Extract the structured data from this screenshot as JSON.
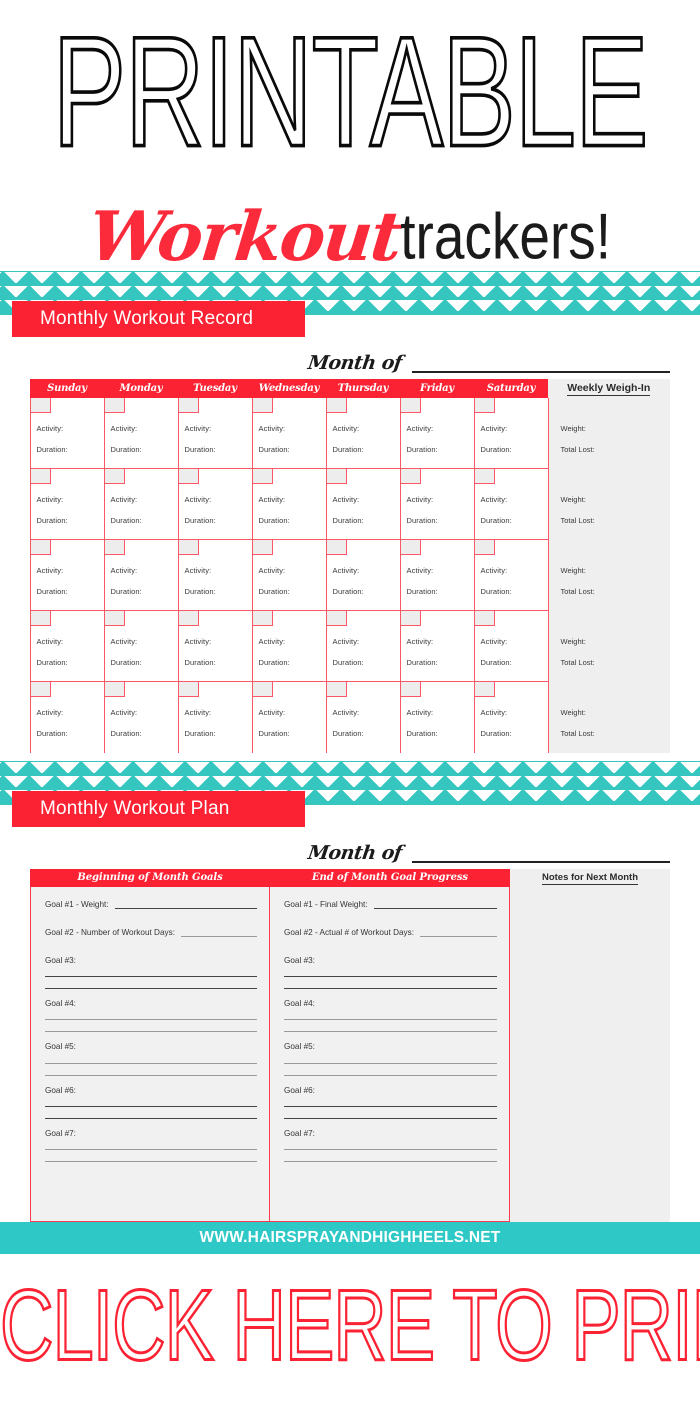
{
  "hero": {
    "title": "PRINTABLE",
    "script_word": "Workout",
    "thin_word": "trackers!"
  },
  "colors": {
    "teal": "#36C6C0",
    "red": "#FB2233",
    "red_light": "#FB5767",
    "gray_panel": "#EFEFEF",
    "footer_teal": "#2EC9C6"
  },
  "section_record": {
    "tab_label": "Monthly Workout Record",
    "month_label": "Month of",
    "day_headers": [
      "Sunday",
      "Monday",
      "Tuesday",
      "Wednesday",
      "Thursday",
      "Friday",
      "Saturday"
    ],
    "weigh_header": "Weekly Weigh-In",
    "cell_labels": {
      "activity": "Activity:",
      "duration": "Duration:"
    },
    "weigh_labels": {
      "weight": "Weight:",
      "total_lost": "Total Lost:"
    },
    "week_count": 5
  },
  "section_plan": {
    "tab_label": "Monthly Workout Plan",
    "month_label": "Month of",
    "begin_header": "Beginning of Month Goals",
    "end_header": "End of Month Goal Progress",
    "notes_header": "Notes for Next Month",
    "begin_goals": [
      {
        "type": "inline",
        "text": "Goal #1 - Weight:",
        "rule": "dark"
      },
      {
        "type": "inline",
        "text": "Goal #2 - Number of Workout Days:",
        "rule": "light"
      },
      {
        "type": "block",
        "text": "Goal #3:",
        "rules": [
          "dark",
          "dark"
        ]
      },
      {
        "type": "block",
        "text": "Goal #4:",
        "rules": [
          "light",
          "light"
        ]
      },
      {
        "type": "block",
        "text": "Goal #5:",
        "rules": [
          "light",
          "light"
        ]
      },
      {
        "type": "block",
        "text": "Goal #6:",
        "rules": [
          "dark",
          "dark"
        ]
      },
      {
        "type": "block",
        "text": "Goal #7:",
        "rules": [
          "light",
          "light"
        ]
      }
    ],
    "end_goals": [
      {
        "type": "inline",
        "text": "Goal #1 - Final Weight:",
        "rule": "dark"
      },
      {
        "type": "inline",
        "text": "Goal #2 - Actual # of Workout Days:",
        "rule": "light"
      },
      {
        "type": "block",
        "text": "Goal #3:",
        "rules": [
          "dark",
          "dark"
        ]
      },
      {
        "type": "block",
        "text": "Goal #4:",
        "rules": [
          "light",
          "light"
        ]
      },
      {
        "type": "block",
        "text": "Goal #5:",
        "rules": [
          "light",
          "light"
        ]
      },
      {
        "type": "block",
        "text": "Goal #6:",
        "rules": [
          "dark",
          "dark"
        ]
      },
      {
        "type": "block",
        "text": "Goal #7:",
        "rules": [
          "light",
          "light"
        ]
      }
    ]
  },
  "footer": {
    "site_url": "WWW.HAIRSPRAYANDHIGHHEELS.NET",
    "cta": "CLICK HERE TO PRINT"
  }
}
